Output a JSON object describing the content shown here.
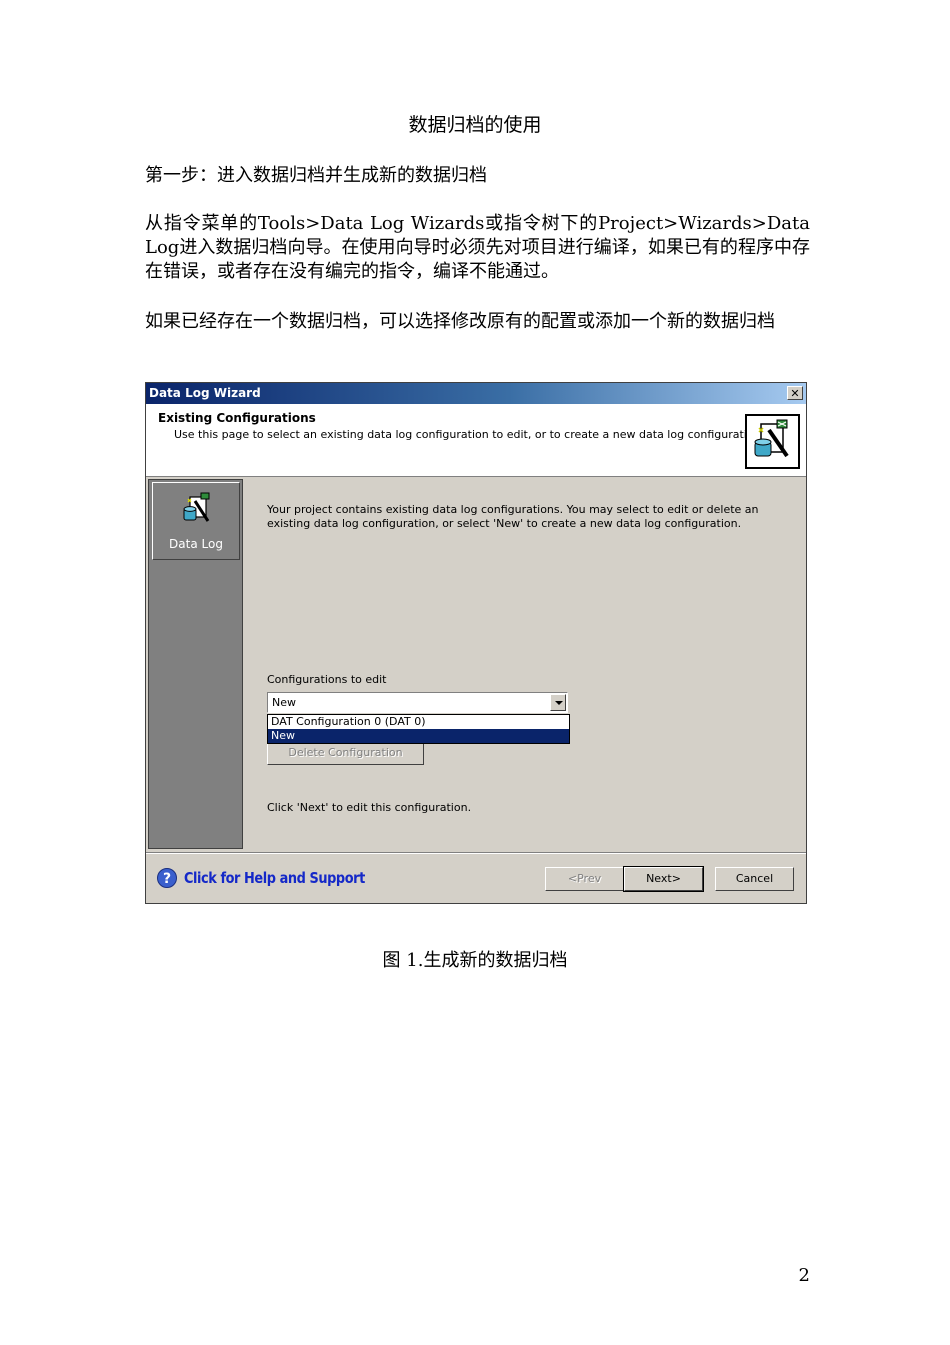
{
  "document": {
    "title": "数据归档的使用",
    "step1": "第一步：进入数据归档并生成新的数据归档",
    "para1": "从指令菜单的Tools>Data Log Wizards或指令树下的Project>Wizards>Data Log进入数据归档向导。在使用向导时必须先对项目进行编译，如果已有的程序中存在错误，或者存在没有编完的指令，编译不能通过。",
    "para2": "如果已经存在一个数据归档，可以选择修改原有的配置或添加一个新的数据归档",
    "caption": "图 1.生成新的数据归档",
    "page_number": "2"
  },
  "wizard": {
    "window_title": "Data Log Wizard",
    "close_label": "✕",
    "header_title": "Existing Configurations",
    "header_subtitle": "Use this page to select an existing data log configuration to edit, or to create a new data log configuration.",
    "sidebar_item_label": "Data Log",
    "main_text": "Your project contains existing data log configurations. You may select to edit or delete an existing data log configuration, or select 'New' to create a new data log configuration.",
    "config_label": "Configurations to edit",
    "config_selected": "New",
    "config_options": [
      "DAT Configuration 0 (DAT 0)",
      "New"
    ],
    "delete_label": "Delete Configuration",
    "hint": "Click 'Next' to edit this configuration.",
    "help_icon": "?",
    "help_link": "Click for Help and Support",
    "prev_label": "<Prev",
    "next_label": "Next>",
    "cancel_label": "Cancel"
  },
  "icons": {
    "header_icon": "data-log-icon",
    "sidebar_icon": "data-log-icon",
    "help": "help-circle-icon"
  }
}
